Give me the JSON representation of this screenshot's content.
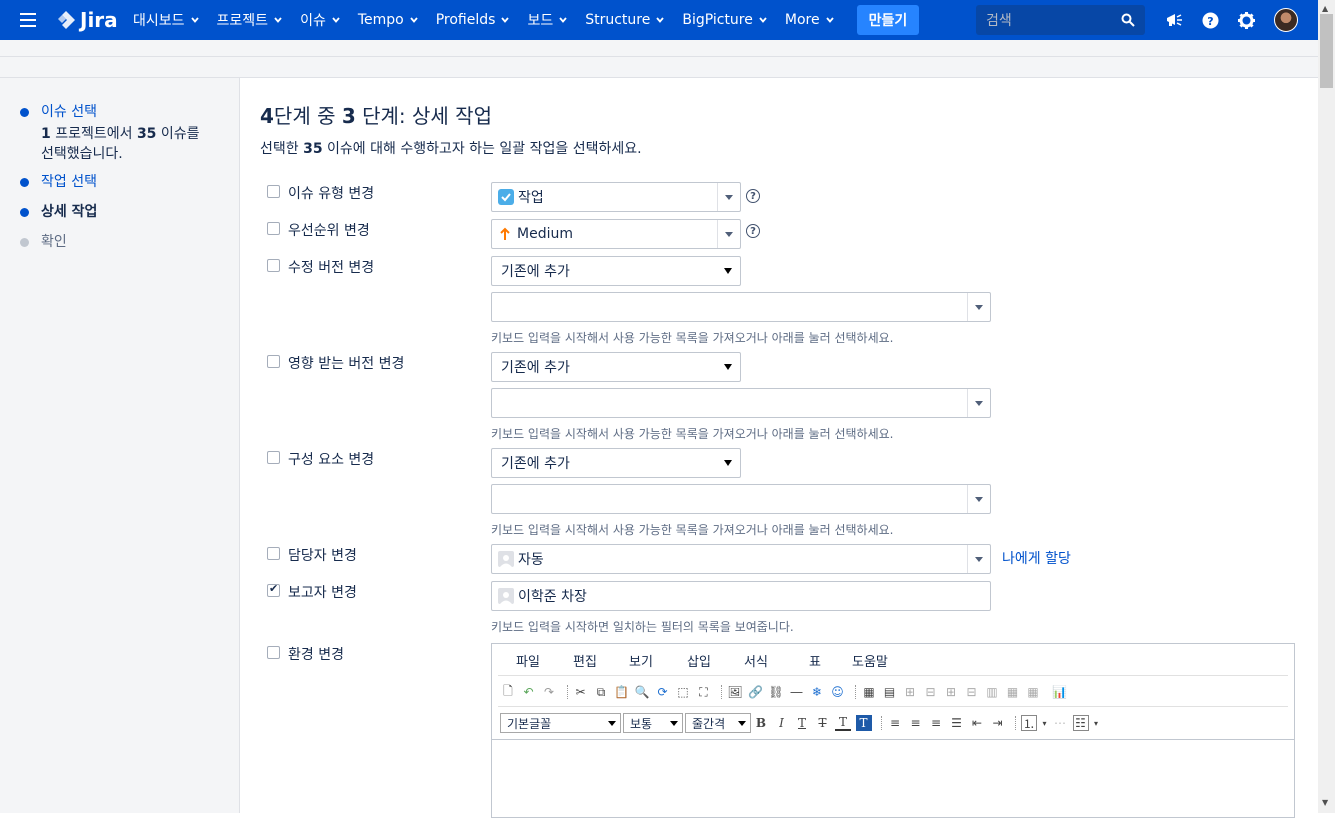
{
  "nav": {
    "logo": "Jira",
    "items": [
      "대시보드",
      "프로젝트",
      "이슈",
      "Tempo",
      "Profields",
      "보드",
      "Structure",
      "BigPicture",
      "More"
    ],
    "create": "만들기",
    "search_placeholder": "검색",
    "icons": [
      "notifications-megaphone-icon",
      "help-icon",
      "settings-gear-icon",
      "user-avatar"
    ]
  },
  "sidebar": {
    "steps": [
      {
        "label": "이슈 선택",
        "state": "done"
      },
      {
        "label": "작업 선택",
        "state": "done"
      },
      {
        "label": "상세 작업",
        "state": "current"
      },
      {
        "label": "확인",
        "state": "future"
      }
    ],
    "step1_detail_line1_prefix": "1",
    "step1_detail_line1_mid": " 프로젝트에서 ",
    "step1_detail_line1_count": "35",
    "step1_detail_line1_suffix": " 이슈를",
    "step1_detail_line2": "선택했습니다."
  },
  "main": {
    "title_prefix": "4",
    "title_mid": "단계 중 ",
    "title_num": "3",
    "title_suffix": " 단계: 상세 작업",
    "desc_prefix": "선택한 ",
    "desc_count": "35",
    "desc_suffix": " 이슈에 대해 수행하고자 하는 일괄 작업을 선택하세요.",
    "rows": {
      "issue_type": {
        "label": "이슈 유형 변경",
        "checked": false,
        "value": "작업"
      },
      "priority": {
        "label": "우선순위 변경",
        "checked": false,
        "value": "Medium"
      },
      "fix_version": {
        "label": "수정 버전 변경",
        "checked": false,
        "mode": "기존에 추가",
        "hint": "키보드 입력을 시작해서 사용 가능한 목록을 가져오거나 아래를 눌러 선택하세요."
      },
      "affects_version": {
        "label": "영향 받는 버전 변경",
        "checked": false,
        "mode": "기존에 추가",
        "hint": "키보드 입력을 시작해서 사용 가능한 목록을 가져오거나 아래를 눌러 선택하세요."
      },
      "component": {
        "label": "구성 요소 변경",
        "checked": false,
        "mode": "기존에 추가",
        "hint": "키보드 입력을 시작해서 사용 가능한 목록을 가져오거나 아래를 눌러 선택하세요."
      },
      "assignee": {
        "label": "담당자 변경",
        "checked": false,
        "value": "자동",
        "assign_me": "나에게 할당"
      },
      "reporter": {
        "label": "보고자 변경",
        "checked": true,
        "value": "이학준 차장",
        "hint": "키보드 입력을 시작하면 일치하는 필터의 목록을 보여줍니다."
      },
      "environment": {
        "label": "환경 변경",
        "checked": false
      }
    },
    "editor": {
      "menu": [
        "파일",
        "편집",
        "보기",
        "삽입",
        "서식",
        "표",
        "도움말"
      ],
      "font_family": "기본글꼴",
      "font_size": "보통",
      "line_height": "줄간격"
    }
  },
  "colors": {
    "nav_bg": "#0052cc",
    "create_bg": "#2684ff",
    "link": "#0052cc",
    "sidebar_bg": "#f4f5f7"
  }
}
